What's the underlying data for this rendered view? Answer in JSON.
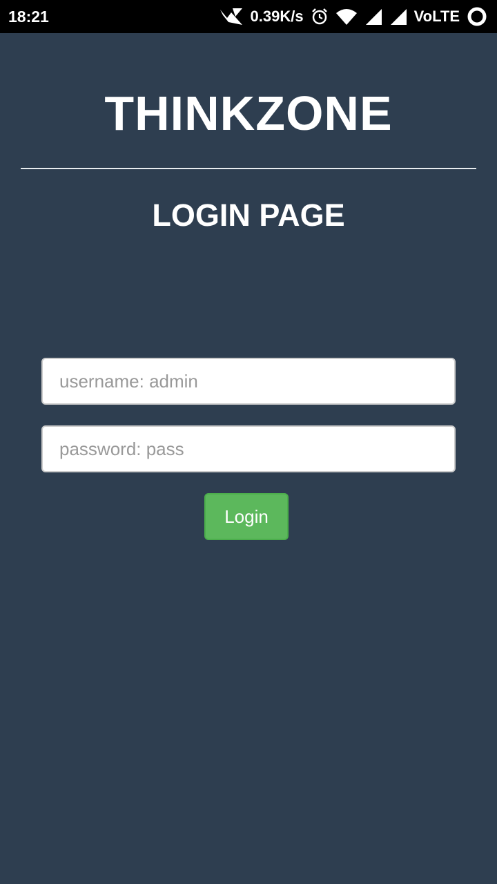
{
  "status_bar": {
    "time": "18:21",
    "net_speed": "0.39K/s",
    "network_label": "VoLTE",
    "icons": [
      "data-saver-icon",
      "alarm-icon",
      "wifi-icon",
      "signal-icon",
      "signal-icon-2",
      "battery-ring-icon"
    ]
  },
  "header": {
    "brand": "THINKZONE",
    "page_title": "LOGIN PAGE"
  },
  "form": {
    "username": {
      "value": "",
      "placeholder": "username: admin"
    },
    "password": {
      "value": "",
      "placeholder": "password: pass"
    },
    "login_label": "Login"
  },
  "colors": {
    "background": "#2e3e50",
    "status_bar": "#000000",
    "button": "#5cb85c",
    "text": "#ffffff"
  }
}
